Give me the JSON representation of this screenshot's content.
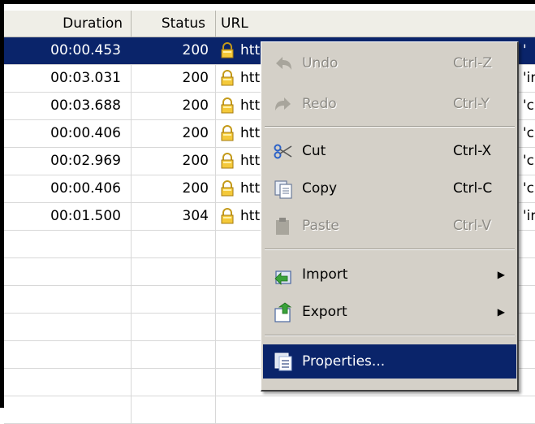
{
  "table": {
    "columns": [
      "Duration",
      "Status",
      "URL"
    ],
    "rows": [
      {
        "duration": "00:00.453",
        "status": "200",
        "url": "htt",
        "selected": true,
        "overflow": "'"
      },
      {
        "duration": "00:03.031",
        "status": "200",
        "url": "htt",
        "selected": false,
        "overflow": "'in"
      },
      {
        "duration": "00:03.688",
        "status": "200",
        "url": "htt",
        "selected": false,
        "overflow": "'c"
      },
      {
        "duration": "00:00.406",
        "status": "200",
        "url": "htt",
        "selected": false,
        "overflow": "'c"
      },
      {
        "duration": "00:02.969",
        "status": "200",
        "url": "htt",
        "selected": false,
        "overflow": "'c"
      },
      {
        "duration": "00:00.406",
        "status": "200",
        "url": "htt",
        "selected": false,
        "overflow": "'c"
      },
      {
        "duration": "00:01.500",
        "status": "304",
        "url": "htt",
        "selected": false,
        "overflow": "'in"
      }
    ],
    "empty_rows": 7
  },
  "menu": {
    "undo": {
      "label": "Undo",
      "shortcut": "Ctrl-Z",
      "icon": "undo-icon"
    },
    "redo": {
      "label": "Redo",
      "shortcut": "Ctrl-Y",
      "icon": "redo-icon"
    },
    "cut": {
      "label": "Cut",
      "shortcut": "Ctrl-X",
      "icon": "scissors-icon"
    },
    "copy": {
      "label": "Copy",
      "shortcut": "Ctrl-C",
      "icon": "copy-icon"
    },
    "paste": {
      "label": "Paste",
      "shortcut": "Ctrl-V",
      "icon": "paste-icon"
    },
    "import": {
      "label": "Import",
      "icon": "import-icon"
    },
    "export": {
      "label": "Export",
      "icon": "export-icon"
    },
    "properties": {
      "label": "Properties...",
      "icon": "properties-icon"
    }
  },
  "colors": {
    "selection": "#0a246a",
    "menu_bg": "#d4d0c8",
    "header_bg": "#efeee7"
  }
}
